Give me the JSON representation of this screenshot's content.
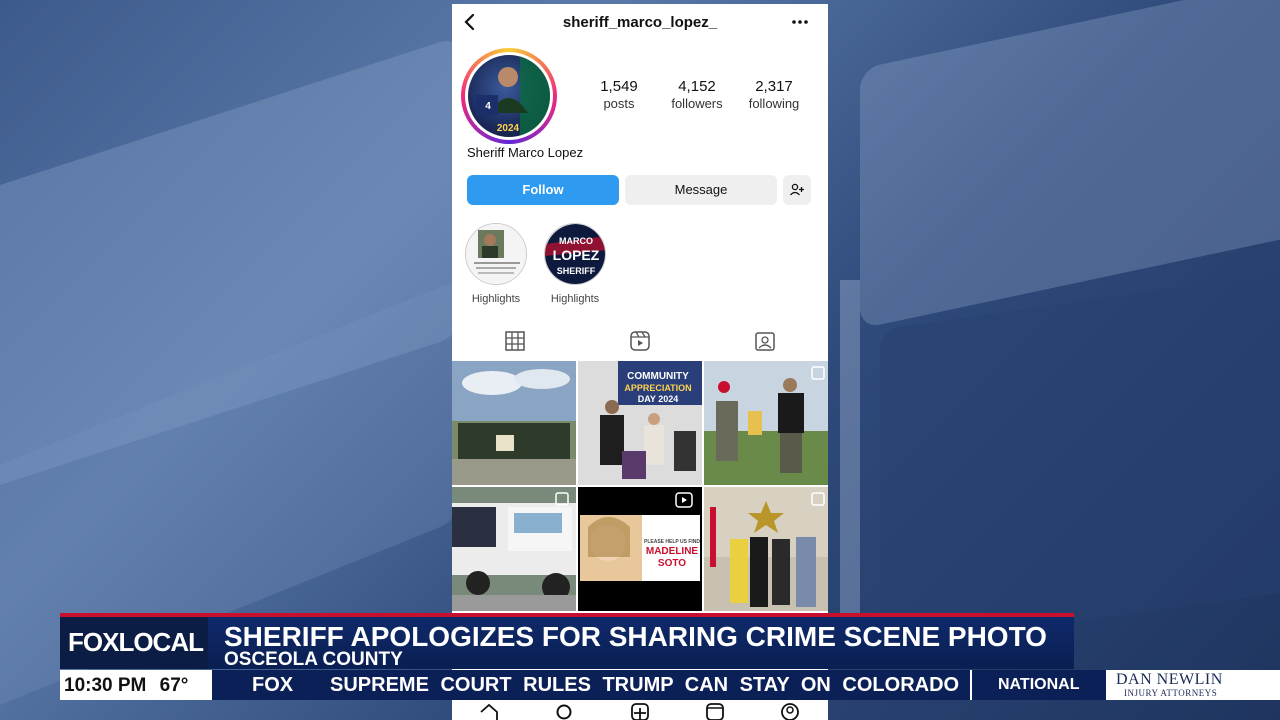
{
  "profile": {
    "username": "sheriff_marco_lopez_",
    "display_name": "Sheriff Marco Lopez",
    "stats": [
      {
        "value": "1,549",
        "label": "posts"
      },
      {
        "value": "4,152",
        "label": "followers"
      },
      {
        "value": "2,317",
        "label": "following"
      }
    ],
    "buttons": {
      "follow": "Follow",
      "message": "Message"
    },
    "highlights": [
      {
        "label": "Highlights"
      },
      {
        "label": "Highlights"
      }
    ],
    "avatar_text": "2024",
    "highlight2_text": [
      "MARCO",
      "LOPEZ",
      "SHERIFF"
    ]
  },
  "posts": [
    {
      "kind": "group-photo-outdoor"
    },
    {
      "kind": "community-appreciation",
      "text": "COMMUNITY APPRECIATION DAY 2024"
    },
    {
      "kind": "handshake-event"
    },
    {
      "kind": "tow-truck"
    },
    {
      "kind": "missing-person",
      "text": [
        "PLEASE HELP US FIND",
        "MADELINE",
        "SOTO"
      ]
    },
    {
      "kind": "office-group"
    }
  ],
  "news": {
    "logo": "FOXLOCAL",
    "headline": "SHERIFF APOLOGIZES FOR SHARING CRIME SCENE PHOTO",
    "subhead": "OSCEOLA COUNTY",
    "time": "10:30 PM",
    "temp": "67°",
    "ticker_brand": "FOX",
    "ticker_text": "SUPREME COURT RULES TRUMP CAN STAY ON COLORADO",
    "section": "NATIONAL",
    "sponsor_name": "DAN NEWLIN",
    "sponsor_sub": "INJURY ATTORNEYS"
  },
  "colors": {
    "follow_blue": "#2f9bf0",
    "news_navy": "#0c2058",
    "news_red": "#c8102e"
  }
}
